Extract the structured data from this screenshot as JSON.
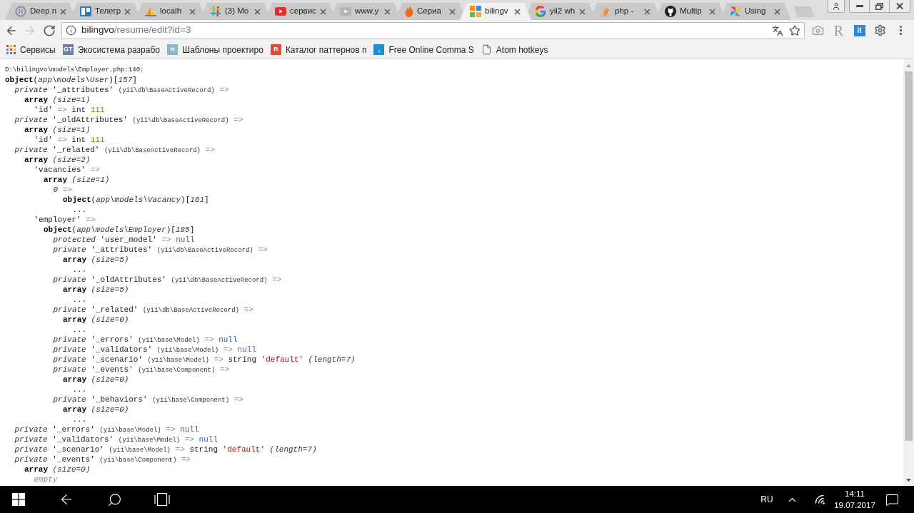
{
  "browser": {
    "tabs": [
      {
        "title": "Deep n",
        "selected": false
      },
      {
        "title": "Телегр",
        "selected": false
      },
      {
        "title": "localh",
        "selected": false
      },
      {
        "title": "(3) Mo",
        "selected": false
      },
      {
        "title": "сервис",
        "selected": false
      },
      {
        "title": "www.y",
        "selected": false
      },
      {
        "title": "Сериа",
        "selected": false
      },
      {
        "title": "bilingv",
        "selected": true
      },
      {
        "title": "yii2 wh",
        "selected": false
      },
      {
        "title": "php -",
        "selected": false
      },
      {
        "title": "Multip",
        "selected": false
      },
      {
        "title": "Using",
        "selected": false
      }
    ],
    "nav_buttons": [
      {
        "kind": "back",
        "disabled": false
      },
      {
        "kind": "forward",
        "disabled": true
      },
      {
        "kind": "reload",
        "disabled": false
      }
    ],
    "address_bar": {
      "host": "bilingvo",
      "path": "/resume/edit?id=3"
    },
    "extensions": [
      {
        "kind": "letter",
        "label": "R"
      },
      {
        "kind": "tile",
        "label": "it"
      }
    ],
    "bookmarks": [
      {
        "kind": "apps",
        "title": "Сервисы"
      },
      {
        "kind": "tile",
        "title": "Экосистема разрабо",
        "icon_text": "GT",
        "color": "#6d7fa6"
      },
      {
        "kind": "tile",
        "title": "Шаблоны проектиро",
        "icon_text": "H",
        "color": "#8db3c7"
      },
      {
        "kind": "tile",
        "title": "Каталог паттернов п",
        "icon_text": "R",
        "color": "#e2483b"
      },
      {
        "kind": "tile",
        "title": "Free Online Comma S",
        "icon_text": ",",
        "color": "#1f8dd6"
      },
      {
        "kind": "page",
        "title": "Atom hotkeys"
      }
    ]
  },
  "page": {
    "location": "D:\\bilingvo\\models\\Employer.php:140:",
    "dump": [
      {
        "parts": [
          {
            "kind": "bold",
            "text": "object"
          },
          {
            "kind": "plain",
            "text": "("
          },
          {
            "kind": "italic",
            "text": "app\\models\\User"
          },
          {
            "kind": "plain",
            "text": ")["
          },
          {
            "kind": "italic",
            "text": "157"
          },
          {
            "kind": "plain",
            "text": "]"
          }
        ],
        "children": [
          {
            "parts": [
              {
                "kind": "italic",
                "text": "private"
              },
              {
                "kind": "plain",
                "text": " '_attributes' "
              },
              {
                "kind": "small",
                "text": "(yii\\db\\BaseActiveRecord)"
              },
              {
                "kind": "arrow",
                "text": " =>"
              }
            ],
            "children": [
              {
                "parts": [
                  {
                    "kind": "bold",
                    "text": "array"
                  },
                  {
                    "kind": "italic",
                    "text": " (size=1)"
                  }
                ],
                "children": [
                  {
                    "parts": [
                      {
                        "kind": "plain",
                        "text": "'id' "
                      },
                      {
                        "kind": "arrow",
                        "text": "=> "
                      },
                      {
                        "kind": "plain",
                        "text": "int "
                      },
                      {
                        "kind": "int",
                        "text": "111"
                      }
                    ]
                  }
                ]
              }
            ]
          },
          {
            "parts": [
              {
                "kind": "italic",
                "text": "private"
              },
              {
                "kind": "plain",
                "text": " '_oldAttributes' "
              },
              {
                "kind": "small",
                "text": "(yii\\db\\BaseActiveRecord)"
              },
              {
                "kind": "arrow",
                "text": " =>"
              }
            ],
            "children": [
              {
                "parts": [
                  {
                    "kind": "bold",
                    "text": "array"
                  },
                  {
                    "kind": "italic",
                    "text": " (size=1)"
                  }
                ],
                "children": [
                  {
                    "parts": [
                      {
                        "kind": "plain",
                        "text": "'id' "
                      },
                      {
                        "kind": "arrow",
                        "text": "=> "
                      },
                      {
                        "kind": "plain",
                        "text": "int "
                      },
                      {
                        "kind": "int",
                        "text": "111"
                      }
                    ]
                  }
                ]
              }
            ]
          },
          {
            "parts": [
              {
                "kind": "italic",
                "text": "private"
              },
              {
                "kind": "plain",
                "text": " '_related' "
              },
              {
                "kind": "small",
                "text": "(yii\\db\\BaseActiveRecord)"
              },
              {
                "kind": "arrow",
                "text": " =>"
              }
            ],
            "children": [
              {
                "parts": [
                  {
                    "kind": "bold",
                    "text": "array"
                  },
                  {
                    "kind": "italic",
                    "text": " (size=2)"
                  }
                ],
                "children": [
                  {
                    "parts": [
                      {
                        "kind": "plain",
                        "text": "'vacancies' "
                      },
                      {
                        "kind": "arrow",
                        "text": "=>"
                      }
                    ],
                    "children": [
                      {
                        "parts": [
                          {
                            "kind": "bold",
                            "text": "array"
                          },
                          {
                            "kind": "italic",
                            "text": " (size=1)"
                          }
                        ],
                        "children": [
                          {
                            "parts": [
                              {
                                "kind": "italic",
                                "text": "0"
                              },
                              {
                                "kind": "arrow",
                                "text": " =>"
                              }
                            ],
                            "children": [
                              {
                                "parts": [
                                  {
                                    "kind": "bold",
                                    "text": "object"
                                  },
                                  {
                                    "kind": "plain",
                                    "text": "("
                                  },
                                  {
                                    "kind": "italic",
                                    "text": "app\\models\\Vacancy"
                                  },
                                  {
                                    "kind": "plain",
                                    "text": ")["
                                  },
                                  {
                                    "kind": "italic",
                                    "text": "161"
                                  },
                                  {
                                    "kind": "plain",
                                    "text": "]"
                                  }
                                ],
                                "children": [
                                  {
                                    "parts": [
                                      {
                                        "kind": "plain",
                                        "text": "..."
                                      }
                                    ]
                                  }
                                ]
                              }
                            ]
                          }
                        ]
                      }
                    ]
                  },
                  {
                    "parts": [
                      {
                        "kind": "plain",
                        "text": "'employer' "
                      },
                      {
                        "kind": "arrow",
                        "text": "=>"
                      }
                    ],
                    "children": [
                      {
                        "parts": [
                          {
                            "kind": "bold",
                            "text": "object"
                          },
                          {
                            "kind": "plain",
                            "text": "("
                          },
                          {
                            "kind": "italic",
                            "text": "app\\models\\Employer"
                          },
                          {
                            "kind": "plain",
                            "text": ")["
                          },
                          {
                            "kind": "italic",
                            "text": "185"
                          },
                          {
                            "kind": "plain",
                            "text": "]"
                          }
                        ],
                        "children": [
                          {
                            "parts": [
                              {
                                "kind": "italic",
                                "text": "protected"
                              },
                              {
                                "kind": "plain",
                                "text": " 'user_model' "
                              },
                              {
                                "kind": "arrow",
                                "text": "=> "
                              },
                              {
                                "kind": "null",
                                "text": "null"
                              }
                            ]
                          },
                          {
                            "parts": [
                              {
                                "kind": "italic",
                                "text": "private"
                              },
                              {
                                "kind": "plain",
                                "text": " '_attributes' "
                              },
                              {
                                "kind": "small",
                                "text": "(yii\\db\\BaseActiveRecord)"
                              },
                              {
                                "kind": "arrow",
                                "text": " =>"
                              }
                            ],
                            "children": [
                              {
                                "parts": [
                                  {
                                    "kind": "bold",
                                    "text": "array"
                                  },
                                  {
                                    "kind": "italic",
                                    "text": " (size=5)"
                                  }
                                ],
                                "children": [
                                  {
                                    "parts": [
                                      {
                                        "kind": "plain",
                                        "text": "..."
                                      }
                                    ]
                                  }
                                ]
                              }
                            ]
                          },
                          {
                            "parts": [
                              {
                                "kind": "italic",
                                "text": "private"
                              },
                              {
                                "kind": "plain",
                                "text": " '_oldAttributes' "
                              },
                              {
                                "kind": "small",
                                "text": "(yii\\db\\BaseActiveRecord)"
                              },
                              {
                                "kind": "arrow",
                                "text": " =>"
                              }
                            ],
                            "children": [
                              {
                                "parts": [
                                  {
                                    "kind": "bold",
                                    "text": "array"
                                  },
                                  {
                                    "kind": "italic",
                                    "text": " (size=5)"
                                  }
                                ],
                                "children": [
                                  {
                                    "parts": [
                                      {
                                        "kind": "plain",
                                        "text": "..."
                                      }
                                    ]
                                  }
                                ]
                              }
                            ]
                          },
                          {
                            "parts": [
                              {
                                "kind": "italic",
                                "text": "private"
                              },
                              {
                                "kind": "plain",
                                "text": " '_related' "
                              },
                              {
                                "kind": "small",
                                "text": "(yii\\db\\BaseActiveRecord)"
                              },
                              {
                                "kind": "arrow",
                                "text": " =>"
                              }
                            ],
                            "children": [
                              {
                                "parts": [
                                  {
                                    "kind": "bold",
                                    "text": "array"
                                  },
                                  {
                                    "kind": "italic",
                                    "text": " (size=0)"
                                  }
                                ],
                                "children": [
                                  {
                                    "parts": [
                                      {
                                        "kind": "plain",
                                        "text": "..."
                                      }
                                    ]
                                  }
                                ]
                              }
                            ]
                          },
                          {
                            "parts": [
                              {
                                "kind": "italic",
                                "text": "private"
                              },
                              {
                                "kind": "plain",
                                "text": " '_errors' "
                              },
                              {
                                "kind": "small",
                                "text": "(yii\\base\\Model)"
                              },
                              {
                                "kind": "arrow",
                                "text": " => "
                              },
                              {
                                "kind": "null",
                                "text": "null"
                              }
                            ]
                          },
                          {
                            "parts": [
                              {
                                "kind": "italic",
                                "text": "private"
                              },
                              {
                                "kind": "plain",
                                "text": " '_validators' "
                              },
                              {
                                "kind": "small",
                                "text": "(yii\\base\\Model)"
                              },
                              {
                                "kind": "arrow",
                                "text": " => "
                              },
                              {
                                "kind": "null",
                                "text": "null"
                              }
                            ]
                          },
                          {
                            "parts": [
                              {
                                "kind": "italic",
                                "text": "private"
                              },
                              {
                                "kind": "plain",
                                "text": " '_scenario' "
                              },
                              {
                                "kind": "small",
                                "text": "(yii\\base\\Model)"
                              },
                              {
                                "kind": "arrow",
                                "text": " => "
                              },
                              {
                                "kind": "plain",
                                "text": "string "
                              },
                              {
                                "kind": "string",
                                "text": "'default'"
                              },
                              {
                                "kind": "italic",
                                "text": " (length=7)"
                              }
                            ]
                          },
                          {
                            "parts": [
                              {
                                "kind": "italic",
                                "text": "private"
                              },
                              {
                                "kind": "plain",
                                "text": " '_events' "
                              },
                              {
                                "kind": "small",
                                "text": "(yii\\base\\Component)"
                              },
                              {
                                "kind": "arrow",
                                "text": " =>"
                              }
                            ],
                            "children": [
                              {
                                "parts": [
                                  {
                                    "kind": "bold",
                                    "text": "array"
                                  },
                                  {
                                    "kind": "italic",
                                    "text": " (size=0)"
                                  }
                                ],
                                "children": [
                                  {
                                    "parts": [
                                      {
                                        "kind": "plain",
                                        "text": "..."
                                      }
                                    ]
                                  }
                                ]
                              }
                            ]
                          },
                          {
                            "parts": [
                              {
                                "kind": "italic",
                                "text": "private"
                              },
                              {
                                "kind": "plain",
                                "text": " '_behaviors' "
                              },
                              {
                                "kind": "small",
                                "text": "(yii\\base\\Component)"
                              },
                              {
                                "kind": "arrow",
                                "text": " =>"
                              }
                            ],
                            "children": [
                              {
                                "parts": [
                                  {
                                    "kind": "bold",
                                    "text": "array"
                                  },
                                  {
                                    "kind": "italic",
                                    "text": " (size=0)"
                                  }
                                ],
                                "children": [
                                  {
                                    "parts": [
                                      {
                                        "kind": "plain",
                                        "text": "..."
                                      }
                                    ]
                                  }
                                ]
                              }
                            ]
                          }
                        ]
                      }
                    ]
                  }
                ]
              }
            ]
          },
          {
            "parts": [
              {
                "kind": "italic",
                "text": "private"
              },
              {
                "kind": "plain",
                "text": " '_errors' "
              },
              {
                "kind": "small",
                "text": "(yii\\base\\Model)"
              },
              {
                "kind": "arrow",
                "text": " => "
              },
              {
                "kind": "null",
                "text": "null"
              }
            ]
          },
          {
            "parts": [
              {
                "kind": "italic",
                "text": "private"
              },
              {
                "kind": "plain",
                "text": " '_validators' "
              },
              {
                "kind": "small",
                "text": "(yii\\base\\Model)"
              },
              {
                "kind": "arrow",
                "text": " => "
              },
              {
                "kind": "null",
                "text": "null"
              }
            ]
          },
          {
            "parts": [
              {
                "kind": "italic",
                "text": "private"
              },
              {
                "kind": "plain",
                "text": " '_scenario' "
              },
              {
                "kind": "small",
                "text": "(yii\\base\\Model)"
              },
              {
                "kind": "arrow",
                "text": " => "
              },
              {
                "kind": "plain",
                "text": "string "
              },
              {
                "kind": "string",
                "text": "'default'"
              },
              {
                "kind": "italic",
                "text": " (length=7)"
              }
            ]
          },
          {
            "parts": [
              {
                "kind": "italic",
                "text": "private"
              },
              {
                "kind": "plain",
                "text": " '_events' "
              },
              {
                "kind": "small",
                "text": "(yii\\base\\Component)"
              },
              {
                "kind": "arrow",
                "text": " =>"
              }
            ],
            "children": [
              {
                "parts": [
                  {
                    "kind": "bold",
                    "text": "array"
                  },
                  {
                    "kind": "italic",
                    "text": " (size=0)"
                  }
                ],
                "children": [
                  {
                    "parts": [
                      {
                        "kind": "muted",
                        "text": "empty"
                      }
                    ]
                  }
                ]
              }
            ]
          }
        ]
      }
    ]
  },
  "taskbar": {
    "language": "RU",
    "time": "14:11",
    "date": "19.07.2017"
  }
}
